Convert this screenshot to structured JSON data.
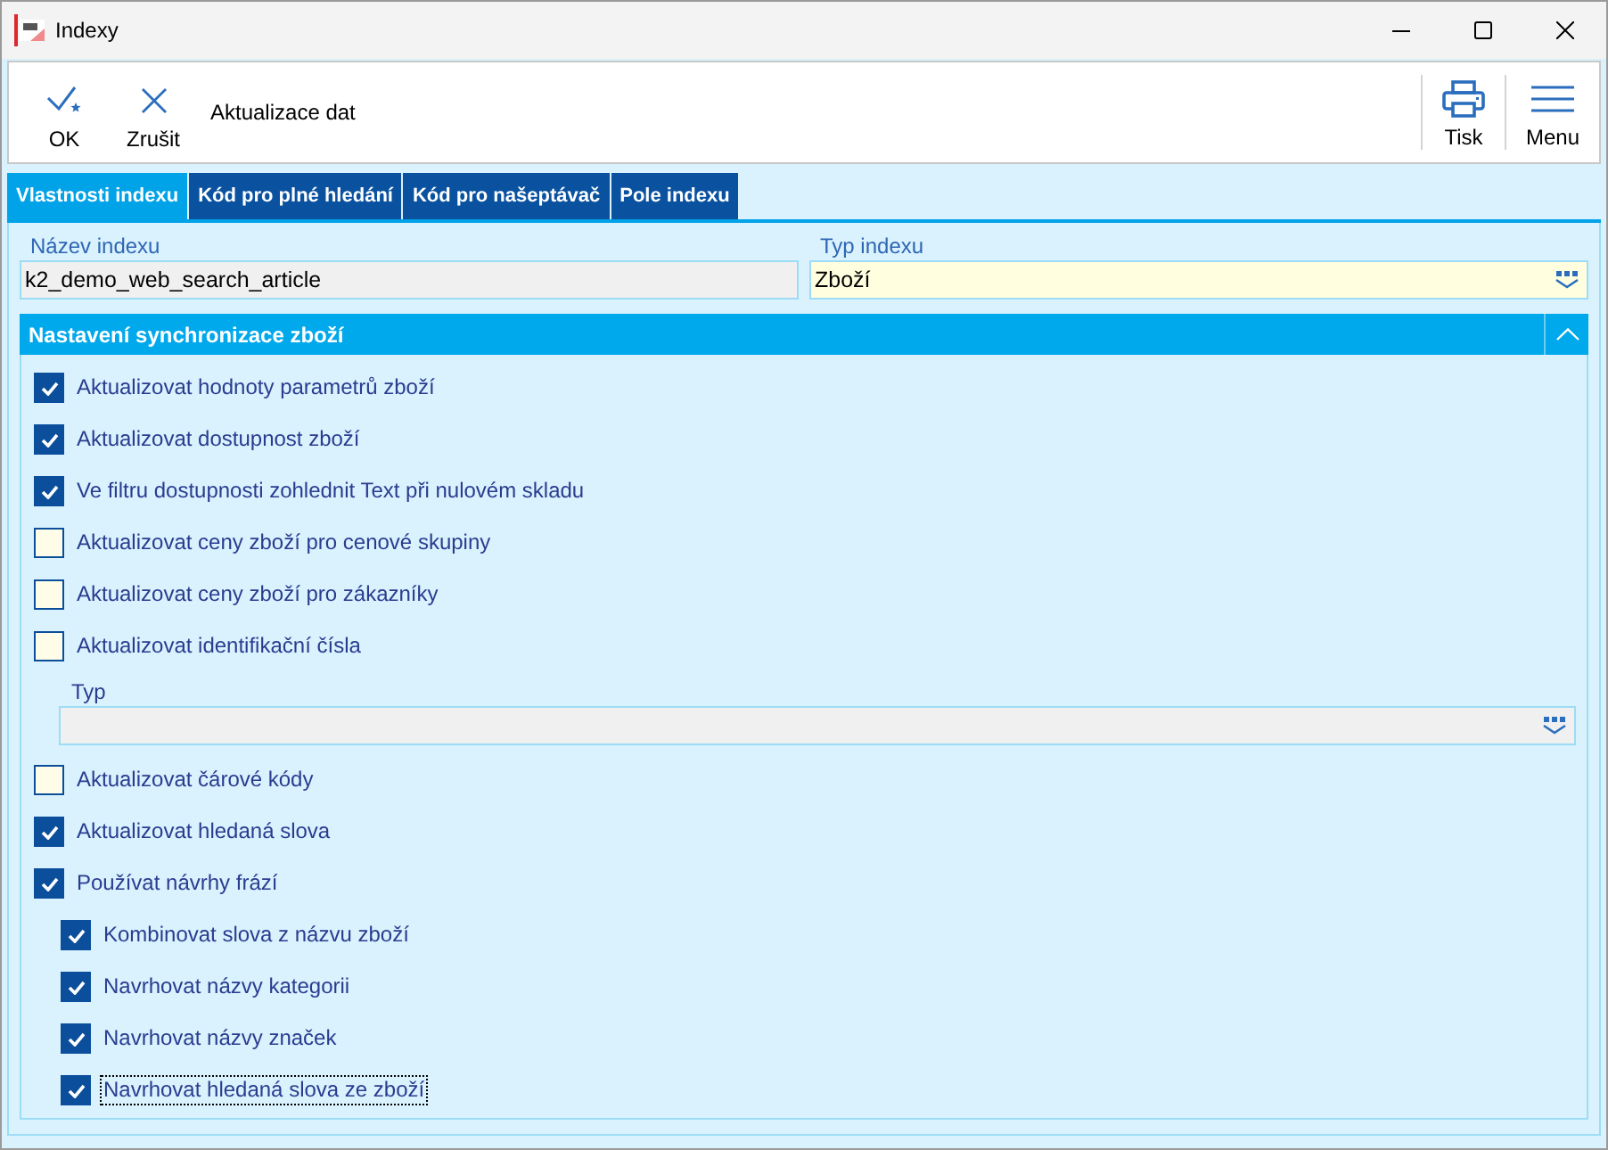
{
  "window": {
    "title": "Indexy"
  },
  "toolbar": {
    "left_buttons": [
      {
        "label": "OK",
        "kind": "ok"
      },
      {
        "label": "Zrušit",
        "kind": "cancel"
      }
    ],
    "caption": "Aktualizace dat",
    "right_buttons": [
      {
        "label": "Tisk",
        "kind": "print"
      },
      {
        "label": "Menu",
        "kind": "menu"
      }
    ]
  },
  "tabs": [
    {
      "label": "Vlastnosti indexu",
      "selected": true
    },
    {
      "label": "Kód pro plné hledání",
      "selected": false
    },
    {
      "label": "Kód pro našeptávač",
      "selected": false
    },
    {
      "label": "Pole indexu",
      "selected": false
    }
  ],
  "fields": [
    {
      "label": "Název indexu",
      "value": "k2_demo_web_search_article",
      "kind": "text",
      "disabled": true
    },
    {
      "label": "Typ indexu",
      "value": "Zboží",
      "kind": "dropdown",
      "disabled": false
    }
  ],
  "section": {
    "title": "Nastavení synchronizace zboží",
    "expanded": true,
    "items": [
      {
        "kind": "checkbox",
        "label": "Aktualizovat hodnoty parametrů zboží",
        "checked": true,
        "focused": false
      },
      {
        "kind": "checkbox",
        "label": "Aktualizovat dostupnost zboží",
        "checked": true,
        "focused": false
      },
      {
        "kind": "checkbox",
        "label": "Ve filtru dostupnosti zohlednit Text při nulovém skladu",
        "checked": true,
        "focused": false
      },
      {
        "kind": "checkbox",
        "label": "Aktualizovat ceny zboží pro cenové skupiny",
        "checked": false,
        "focused": false
      },
      {
        "kind": "checkbox",
        "label": "Aktualizovat ceny zboží pro zákazníky",
        "checked": false,
        "focused": false
      },
      {
        "kind": "checkbox",
        "label": "Aktualizovat identifikační čísla",
        "checked": false,
        "focused": false
      },
      {
        "kind": "dropdown",
        "label": "Typ",
        "disabled": true
      },
      {
        "kind": "checkbox",
        "label": "Aktualizovat čárové kódy",
        "checked": false,
        "focused": false
      },
      {
        "kind": "checkbox",
        "label": "Aktualizovat hledaná slova",
        "checked": true,
        "focused": false
      },
      {
        "kind": "checkbox",
        "label": "Používat návrhy frází",
        "checked": true,
        "focused": false,
        "children": [
          {
            "kind": "checkbox",
            "label": "Kombinovat slova z názvu zboží",
            "checked": true,
            "focused": false
          },
          {
            "kind": "checkbox",
            "label": "Navrhovat názvy kategorii",
            "checked": true,
            "focused": false
          },
          {
            "kind": "checkbox",
            "label": "Navrhovat názvy značek",
            "checked": true,
            "focused": false
          },
          {
            "kind": "checkbox",
            "label": "Navrhovat hledaná slova ze zboží",
            "checked": true,
            "focused": true
          }
        ]
      }
    ]
  }
}
